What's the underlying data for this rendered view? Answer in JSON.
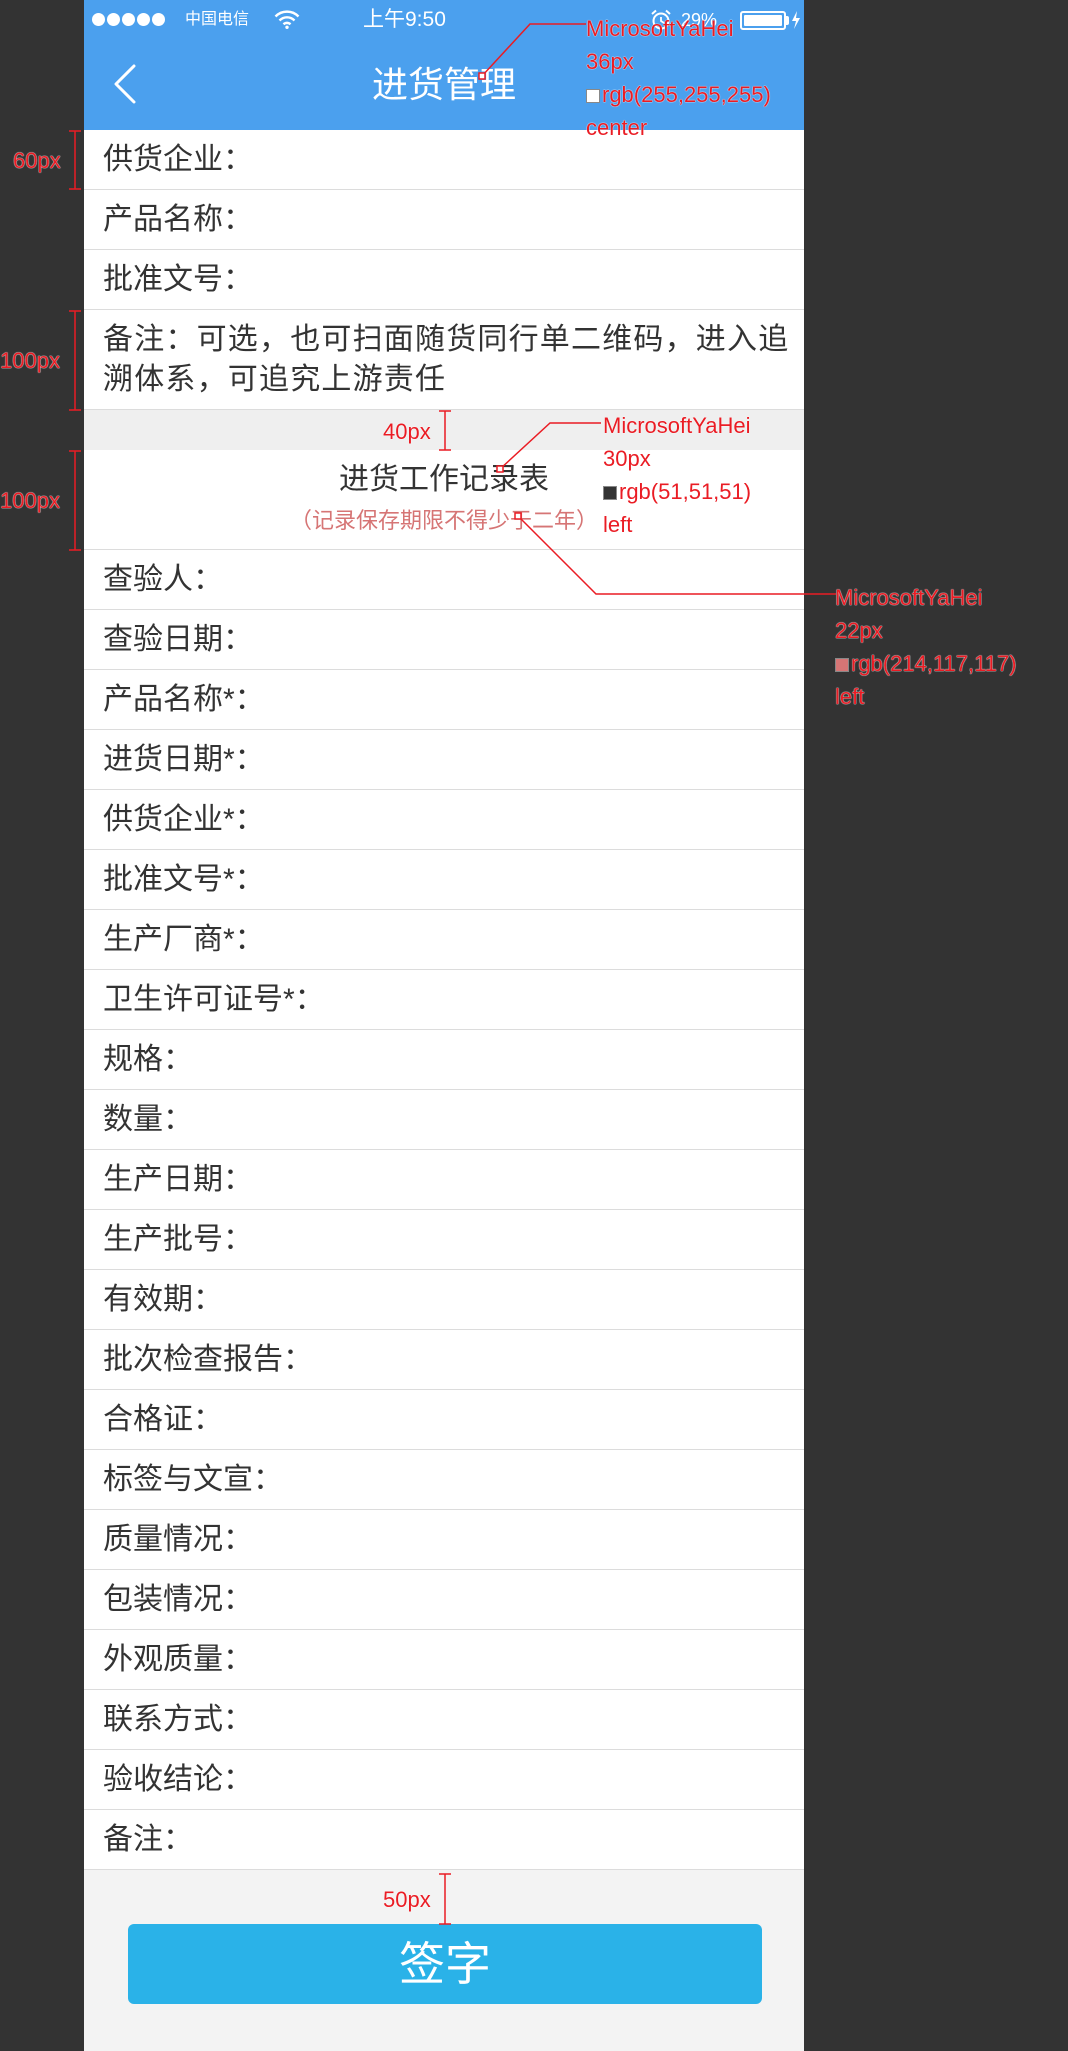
{
  "status_bar": {
    "signal_icon": "signal-dots-icon",
    "carrier": "中国电信",
    "wifi_icon": "wifi-icon",
    "time": "上午9:50",
    "alarm_icon": "alarm-clock-icon",
    "battery_percent": "29%",
    "battery_icon": "battery-icon",
    "charging_icon": "charging-bolt-icon"
  },
  "header": {
    "back_icon": "chevron-left-icon",
    "title": "进货管理",
    "background_color": "#4ba0ee"
  },
  "supplier_info": {
    "rows": [
      {
        "label": "供货企业："
      },
      {
        "label": "产品名称："
      },
      {
        "label": "批准文号："
      }
    ],
    "note": "备注：可选，也可扫面随货同行单二维码，进入追溯体系，可追究上游责任"
  },
  "record_table": {
    "title": "进货工作记录表",
    "subtitle": "（记录保存期限不得少于二年）",
    "subtitle_color": "#d67575",
    "rows": [
      {
        "label": "查验人："
      },
      {
        "label": "查验日期："
      },
      {
        "label": "产品名称*："
      },
      {
        "label": "进货日期*："
      },
      {
        "label": "供货企业*："
      },
      {
        "label": "批准文号*："
      },
      {
        "label": "生产厂商*："
      },
      {
        "label": "卫生许可证号*："
      },
      {
        "label": "规格："
      },
      {
        "label": "数量："
      },
      {
        "label": "生产日期："
      },
      {
        "label": "生产批号："
      },
      {
        "label": "有效期："
      },
      {
        "label": "批次检查报告："
      },
      {
        "label": "合格证："
      },
      {
        "label": "标签与文宣："
      },
      {
        "label": "质量情况："
      },
      {
        "label": "包装情况："
      },
      {
        "label": "外观质量："
      },
      {
        "label": "联系方式："
      },
      {
        "label": "验收结论："
      },
      {
        "label": "备注："
      }
    ]
  },
  "sign_button": {
    "label": "签字",
    "color": "#2ab2e8"
  },
  "annotations": {
    "marker_color": "#ea1c24",
    "header_title_spec": {
      "typeface": "MicrosoftYaHei",
      "size_label": "36px",
      "color_label": "rgb(255,255,255)",
      "swatch": "#ffffff",
      "align": "center"
    },
    "table_title_spec": {
      "typeface": "MicrosoftYaHei",
      "size_label": "30px",
      "color_label": "rgb(51,51,51)",
      "swatch": "#333333",
      "align": "left"
    },
    "table_subtitle_spec": {
      "typeface": "MicrosoftYaHei",
      "size_label": "22px",
      "color_label": "rgb(214,117,117)",
      "swatch": "#d67575",
      "align": "left"
    },
    "row_height_label": "60px",
    "note_row_height_label": "100px",
    "section_gap_label": "40px",
    "table_head_height_label": "100px",
    "button_gap_label": "50px"
  }
}
